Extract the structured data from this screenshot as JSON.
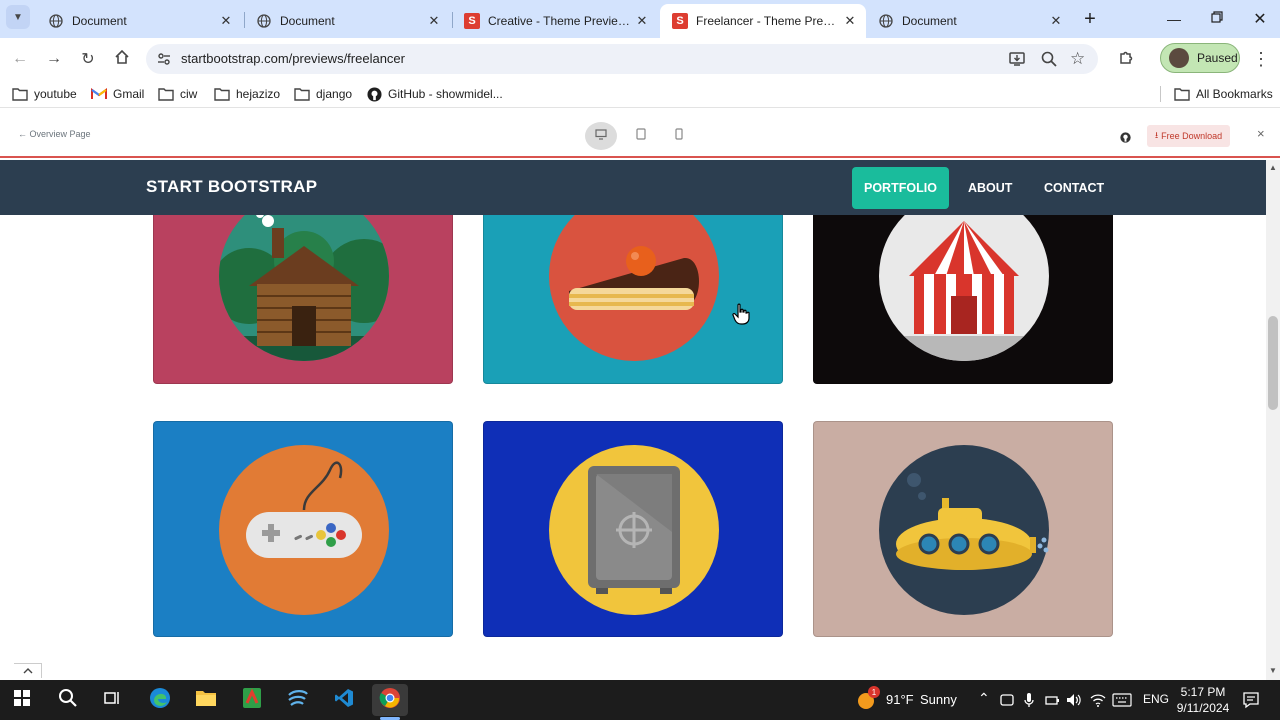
{
  "browser": {
    "tabs": [
      {
        "title": "Document",
        "favicon": "globe-icon"
      },
      {
        "title": "Document",
        "favicon": "globe-icon"
      },
      {
        "title": "Creative - Theme Preview - S",
        "favicon": "startbootstrap-icon"
      },
      {
        "title": "Freelancer - Theme Preview",
        "favicon": "startbootstrap-icon",
        "active": true
      },
      {
        "title": "Document",
        "favicon": "globe-icon"
      }
    ],
    "url": "startbootstrap.com/previews/freelancer",
    "profile_label": "Paused",
    "bookmarks": [
      {
        "label": "youtube",
        "icon": "folder-icon"
      },
      {
        "label": "Gmail",
        "icon": "gmail-icon"
      },
      {
        "label": "ciw",
        "icon": "folder-icon"
      },
      {
        "label": "hejazizo",
        "icon": "folder-icon"
      },
      {
        "label": "django",
        "icon": "folder-icon"
      },
      {
        "label": "GitHub - showmidel...",
        "icon": "github-icon"
      }
    ],
    "all_bookmarks": "All Bookmarks"
  },
  "preview_bar": {
    "back_link": "← Overview Page",
    "download_label": "Free Download",
    "close_label": "×"
  },
  "site": {
    "brand": "START BOOTSTRAP",
    "nav": [
      {
        "label": "PORTFOLIO",
        "active": true
      },
      {
        "label": "ABOUT"
      },
      {
        "label": "CONTACT"
      }
    ],
    "portfolio": [
      {
        "name": "cabin",
        "bg": "#b9415f",
        "circle": "#2e8f7b"
      },
      {
        "name": "cake",
        "bg": "#1aa0b7",
        "circle": "#d9533f"
      },
      {
        "name": "circus",
        "bg": "#0d0a0b",
        "circle": "#e9e9e9"
      },
      {
        "name": "game",
        "bg": "#1b7fc4",
        "circle": "#e17b35"
      },
      {
        "name": "safe",
        "bg": "#0f2fb7",
        "circle": "#f1c53c"
      },
      {
        "name": "submarine",
        "bg": "#c9ada3",
        "circle": "#2c3e50"
      }
    ],
    "accent": "#1abc9c"
  },
  "taskbar": {
    "weather_temp": "91°F",
    "weather_desc": "Sunny",
    "lang": "ENG",
    "time": "5:17 PM",
    "date": "9/11/2024",
    "weather_badge": "1"
  }
}
